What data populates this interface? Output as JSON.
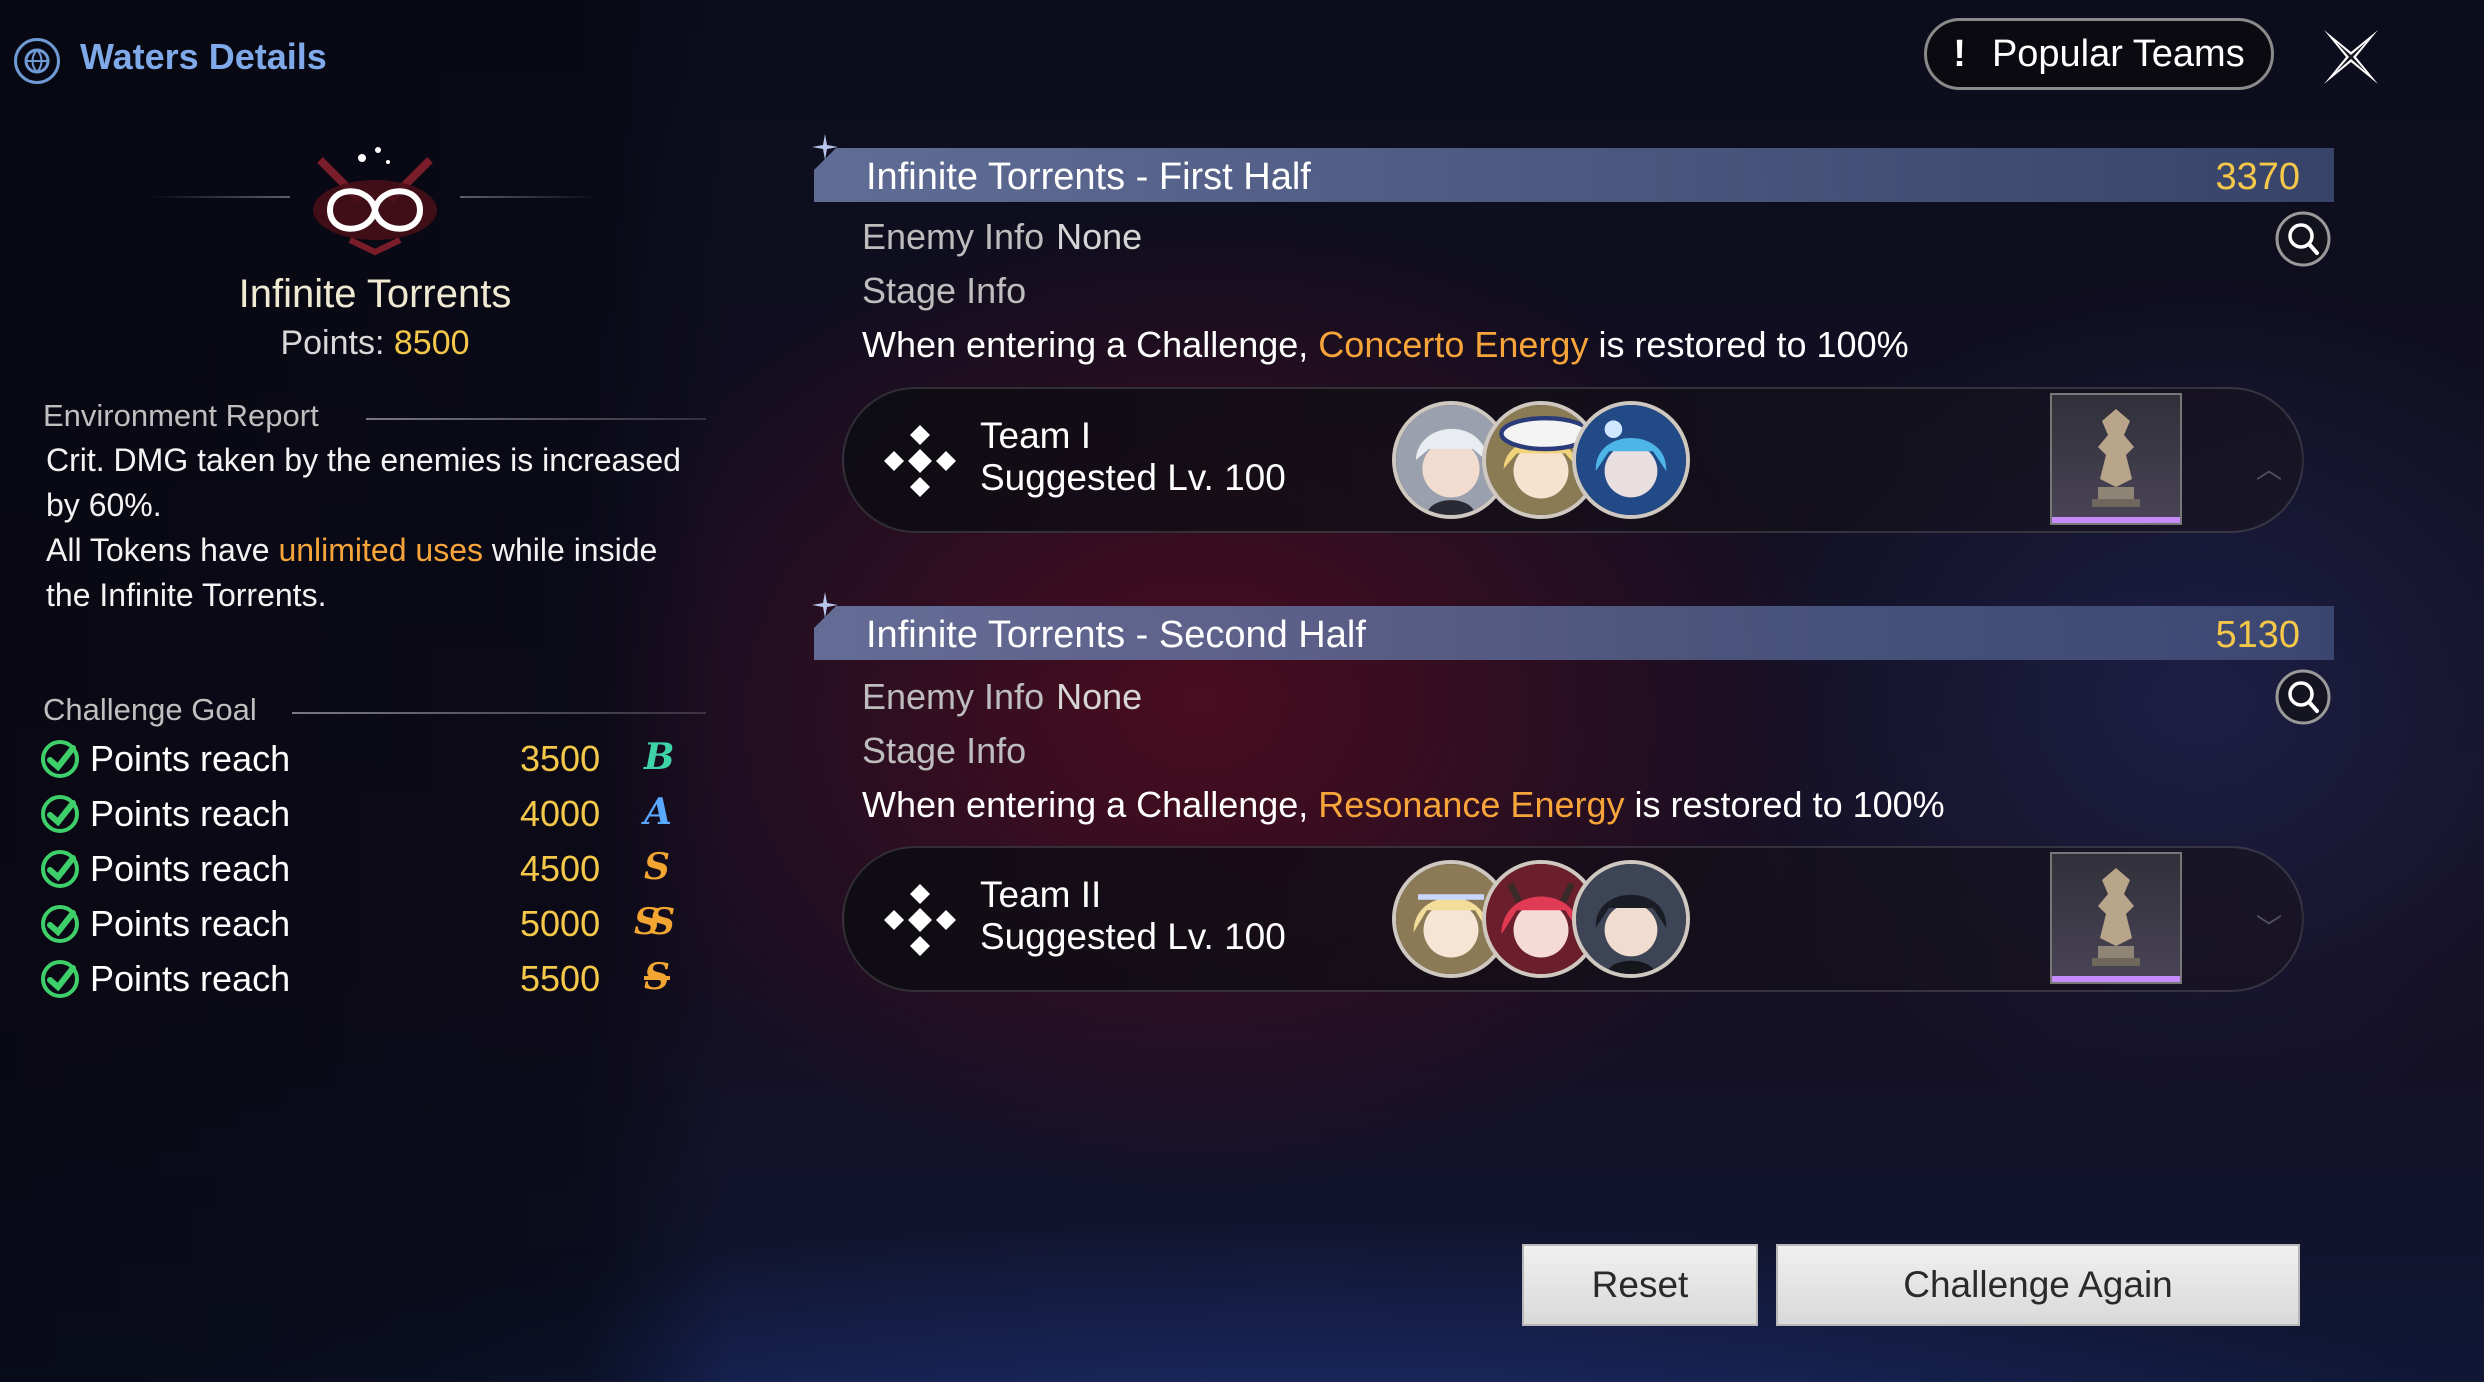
{
  "header": {
    "title": "Waters Details"
  },
  "left_panel": {
    "mode_name": "Infinite Torrents",
    "points_label": "Points:",
    "points_value": "8500",
    "environment": {
      "heading": "Environment Report",
      "line1": "Crit. DMG taken by the enemies is increased by 60%.",
      "line2_pre": "All Tokens have ",
      "line2_highlight": "unlimited uses",
      "line2_post": " while inside the Infinite Torrents."
    },
    "goals": {
      "heading": "Challenge Goal",
      "items": [
        {
          "label": "Points reach",
          "value": "3500",
          "rank": "B",
          "rank_color": "#3fd3a8"
        },
        {
          "label": "Points reach",
          "value": "4000",
          "rank": "A",
          "rank_color": "#5aa8ff"
        },
        {
          "label": "Points reach",
          "value": "4500",
          "rank": "S",
          "rank_color": "#f2a531"
        },
        {
          "label": "Points reach",
          "value": "5000",
          "rank": "SS",
          "rank_color": "#f2a531"
        },
        {
          "label": "Points reach",
          "value": "5500",
          "rank": "S",
          "rank_color": "#f2a531"
        }
      ]
    }
  },
  "top_right": {
    "popular_icon": "!",
    "popular_label": "Popular Teams",
    "close_icon": "close-icon"
  },
  "stages": [
    {
      "title": "Infinite Torrents - First Half",
      "score": "3370",
      "enemy_label": "Enemy Info",
      "enemy_value": "None",
      "stage_info_label": "Stage Info",
      "desc_pre": "When entering a Challenge, ",
      "desc_highlight": "Concerto Energy",
      "desc_post": " is restored to 100%",
      "team_name": "Team I",
      "team_level": "Suggested Lv. 100"
    },
    {
      "title": "Infinite Torrents - Second Half",
      "score": "5130",
      "enemy_label": "Enemy Info",
      "enemy_value": "None",
      "stage_info_label": "Stage Info",
      "desc_pre": "When entering a Challenge, ",
      "desc_highlight": "Resonance Energy",
      "desc_post": " is restored to 100%",
      "team_name": "Team II",
      "team_level": "Suggested Lv. 100"
    }
  ],
  "buttons": {
    "reset": "Reset",
    "challenge_again": "Challenge Again"
  },
  "colors": {
    "gold": "#f5c84a",
    "highlight": "#f7a53a",
    "check": "#3fcf6a",
    "header_blue": "#7fa9e8"
  }
}
